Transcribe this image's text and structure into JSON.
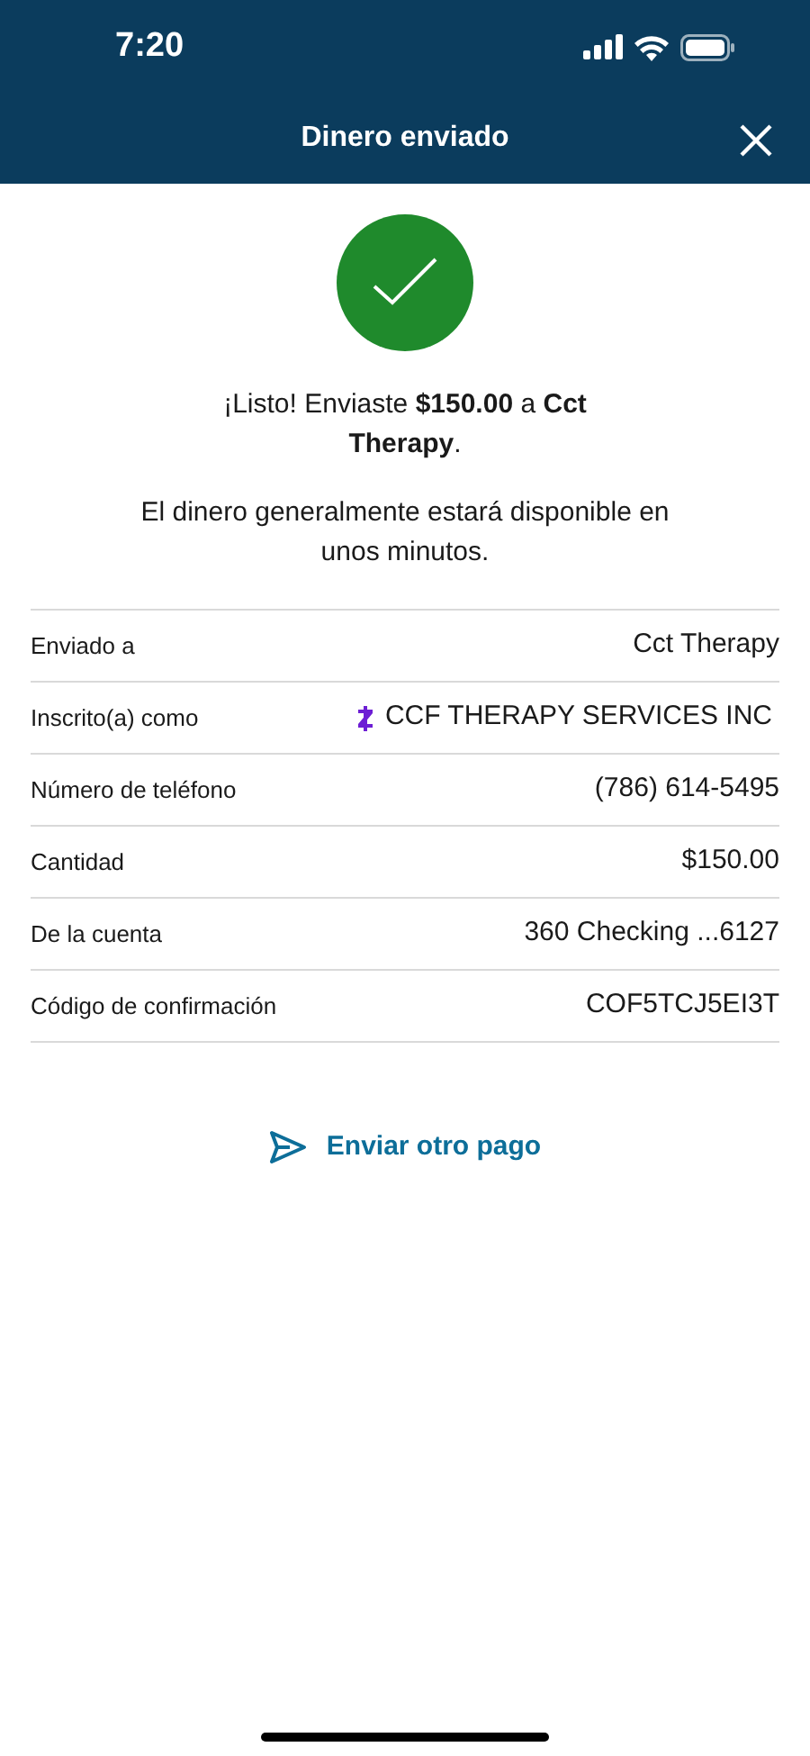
{
  "status_bar": {
    "time": "7:20"
  },
  "header": {
    "title": "Dinero enviado"
  },
  "message": "¡Listo! Enviaste **$150.00** a **Cct Therapy**.",
  "note": "El dinero generalmente estará disponible en unos minutos.",
  "details": [
    {
      "kind": "plain",
      "label": "Enviado a",
      "value": "Cct Therapy"
    },
    {
      "kind": "zelle",
      "label": "Inscrito(a) como",
      "value": "CCF THERAPY SERVICES INC"
    },
    {
      "kind": "plain",
      "label": "Número de teléfono",
      "value": "(786) 614-5495"
    },
    {
      "kind": "plain",
      "label": "Cantidad",
      "value": "$150.00"
    },
    {
      "kind": "plain",
      "label": "De la cuenta",
      "value": "360 Checking ...6127"
    },
    {
      "kind": "plain",
      "label": "Código de confirmación",
      "value": "COF5TCJ5EI3T"
    }
  ],
  "action": {
    "label": "Enviar otro pago"
  }
}
